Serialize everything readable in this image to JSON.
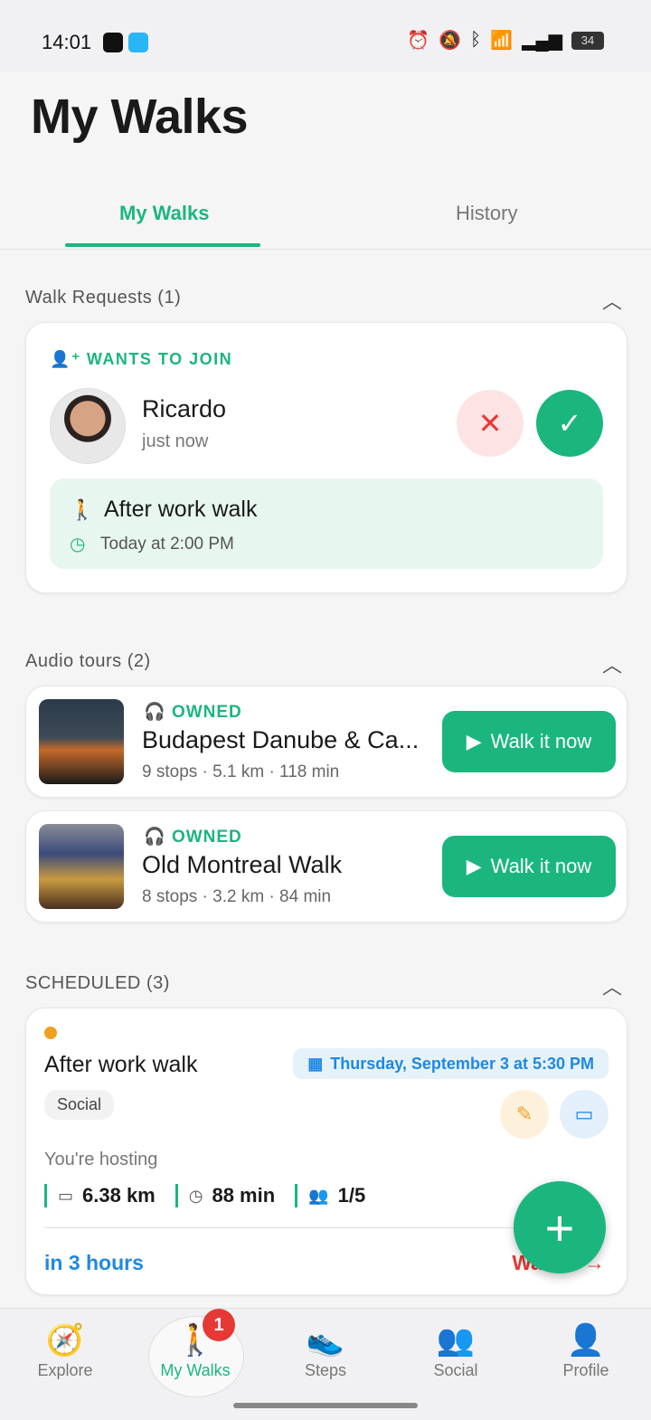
{
  "status_bar": {
    "time": "14:01",
    "battery": "34"
  },
  "page": {
    "title": "My Walks"
  },
  "tabs": [
    {
      "label": "My Walks"
    },
    {
      "label": "History"
    }
  ],
  "walk_requests": {
    "header": "Walk Requests (1)",
    "badge": "WANTS TO JOIN",
    "requester_name": "Ricardo",
    "requested_time": "just now",
    "walk_title": "After work walk",
    "walk_time": "Today at 2:00 PM"
  },
  "audio_tours": {
    "header": "Audio tours (2)",
    "items": [
      {
        "badge": "OWNED",
        "title": "Budapest Danube & Ca...",
        "meta": "9 stops · 5.1 km · 118 min",
        "button": "Walk it now"
      },
      {
        "badge": "OWNED",
        "title": "Old Montreal Walk",
        "meta": "8 stops · 3.2 km · 84 min",
        "button": "Walk it now"
      }
    ]
  },
  "scheduled": {
    "header": "SCHEDULED (3)",
    "walk": {
      "title": "After work walk",
      "date": "Thursday, September 3 at 5:30 PM",
      "tag": "Social",
      "role": "You're hosting",
      "distance": "6.38 km",
      "duration": "88 min",
      "participants": "1/5",
      "countdown": "in 3 hours",
      "action": "Walk it →"
    }
  },
  "bottom_nav": {
    "items": [
      {
        "label": "Explore"
      },
      {
        "label": "My Walks",
        "badge": "1"
      },
      {
        "label": "Steps"
      },
      {
        "label": "Social"
      },
      {
        "label": "Profile"
      }
    ]
  },
  "colors": {
    "accent": "#1ab67e",
    "danger": "#e53935",
    "info": "#1e88e5",
    "warning": "#f0a020"
  }
}
